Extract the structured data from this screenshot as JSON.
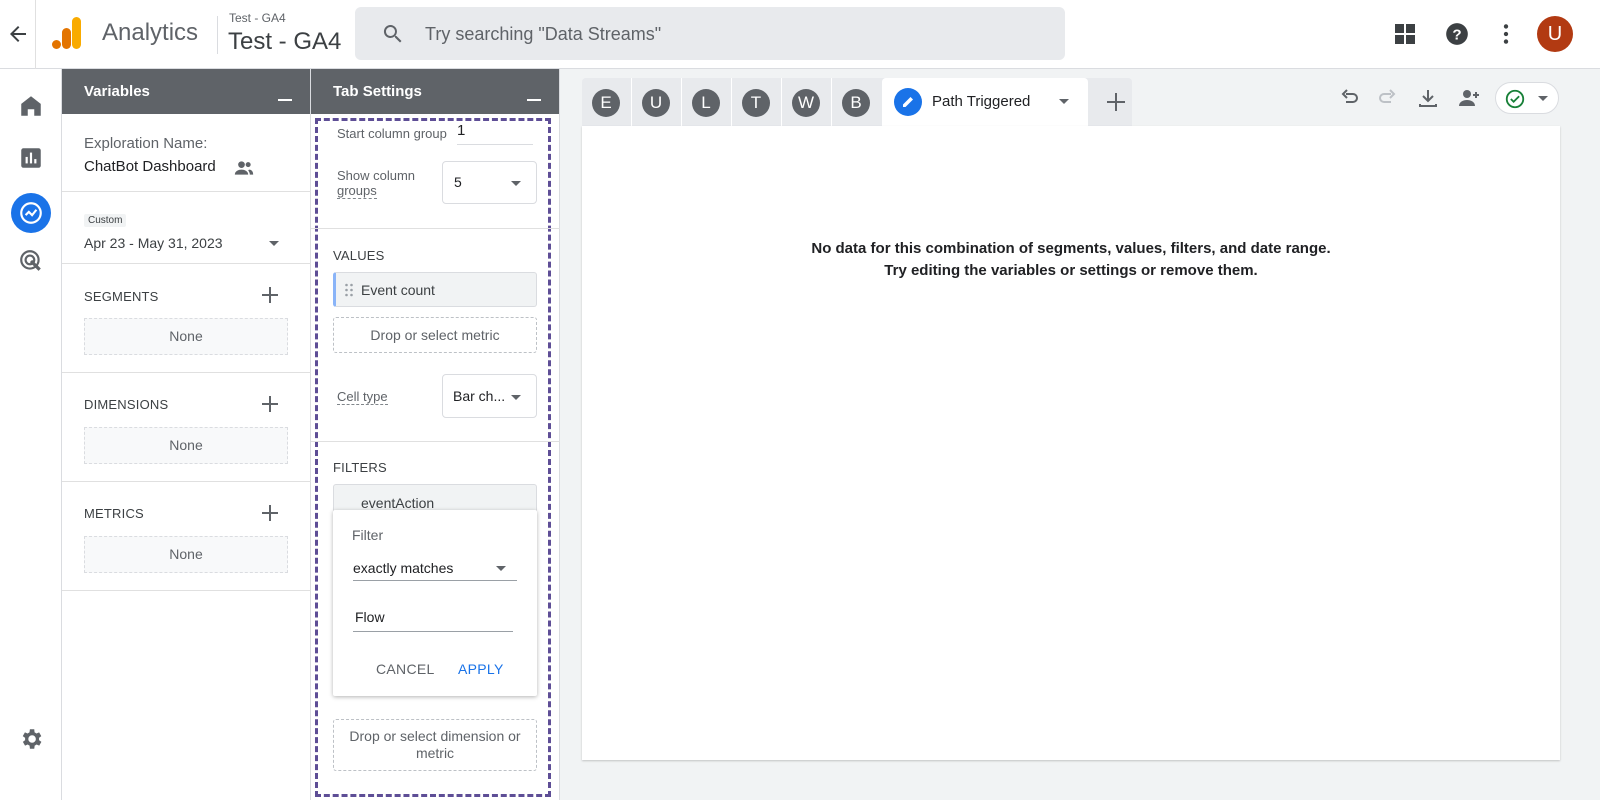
{
  "header": {
    "app_name": "Analytics",
    "property_account": "Test - GA4",
    "property_name": "Test - GA4",
    "search_placeholder": "Try searching \"Data Streams\"",
    "avatar_initial": "U"
  },
  "nav_rail": {
    "items": [
      "home-icon",
      "reports-icon",
      "explore-icon",
      "advertising-icon",
      "settings-icon"
    ],
    "active": "explore-icon",
    "accent": "#1a73e8"
  },
  "variables_panel": {
    "title": "Variables",
    "exploration_label": "Exploration Name:",
    "exploration_name": "ChatBot Dashboard",
    "date_badge": "Custom",
    "date_range": "Apr 23 - May 31, 2023",
    "segments": {
      "label": "SEGMENTS",
      "value": "None"
    },
    "dimensions": {
      "label": "DIMENSIONS",
      "value": "None"
    },
    "metrics": {
      "label": "METRICS",
      "value": "None"
    }
  },
  "tab_settings": {
    "title": "Tab Settings",
    "start_column_group_label": "Start column group",
    "start_column_group_value": "1",
    "show_column_groups_line1": "Show column",
    "show_column_groups_line2": "groups",
    "show_column_groups_value": "5",
    "values_label": "VALUES",
    "value_chip": "Event count",
    "drop_metric": "Drop or select metric",
    "cell_type_label": "Cell type",
    "cell_type_value": "Bar ch...",
    "filters_label": "FILTERS",
    "filter_chip": "eventAction",
    "filter_popup": {
      "title": "Filter",
      "match_type": "exactly matches",
      "value": "Flow",
      "cancel": "CANCEL",
      "apply": "APPLY"
    },
    "drop_dimension_line1": "Drop or select dimension or",
    "drop_dimension_line2": "metric"
  },
  "canvas": {
    "tabs": [
      "E",
      "U",
      "L",
      "T",
      "W",
      "B"
    ],
    "active_tab": "Path Triggered",
    "message_line1": "No data for this combination of segments, values, filters, and date range.",
    "message_line2": "Try editing the variables or settings or remove them."
  }
}
